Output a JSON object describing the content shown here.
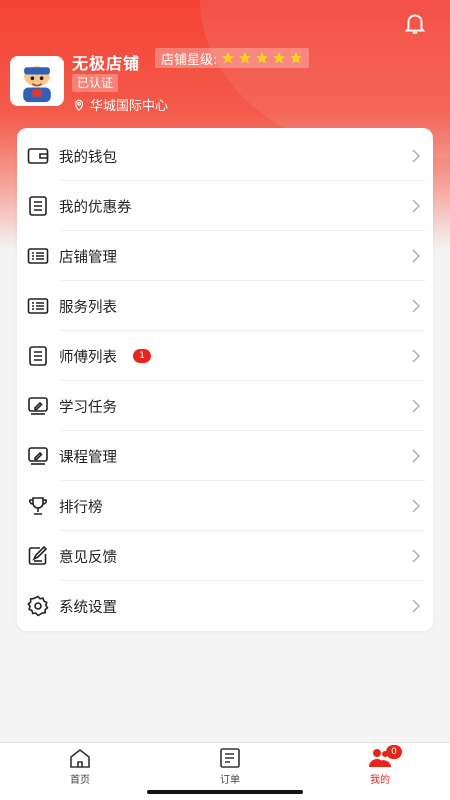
{
  "header": {
    "shop_name": "无极店铺",
    "star_label": "店铺星级:",
    "star_rating": 5,
    "certified_label": "已认证",
    "location": "华城国际中心",
    "accent_color": "#f44336"
  },
  "menu": {
    "items": [
      {
        "label": "我的钱包",
        "icon": "wallet-icon"
      },
      {
        "label": "我的优惠券",
        "icon": "coupon-list-icon"
      },
      {
        "label": "店铺管理",
        "icon": "store-list-icon"
      },
      {
        "label": "服务列表",
        "icon": "service-list-icon"
      },
      {
        "label": "师傅列表",
        "icon": "worker-list-icon",
        "badge": "1"
      },
      {
        "label": "学习任务",
        "icon": "study-task-icon"
      },
      {
        "label": "课程管理",
        "icon": "course-icon"
      },
      {
        "label": "排行榜",
        "icon": "trophy-icon"
      },
      {
        "label": "意见反馈",
        "icon": "feedback-icon"
      },
      {
        "label": "系统设置",
        "icon": "settings-gear-icon"
      }
    ]
  },
  "tabbar": {
    "tabs": [
      {
        "label": "首页",
        "icon": "home-icon"
      },
      {
        "label": "订单",
        "icon": "order-icon"
      },
      {
        "label": "我的",
        "icon": "profile-icon",
        "badge": "0",
        "active": true
      }
    ],
    "active_color": "#e8251b"
  }
}
